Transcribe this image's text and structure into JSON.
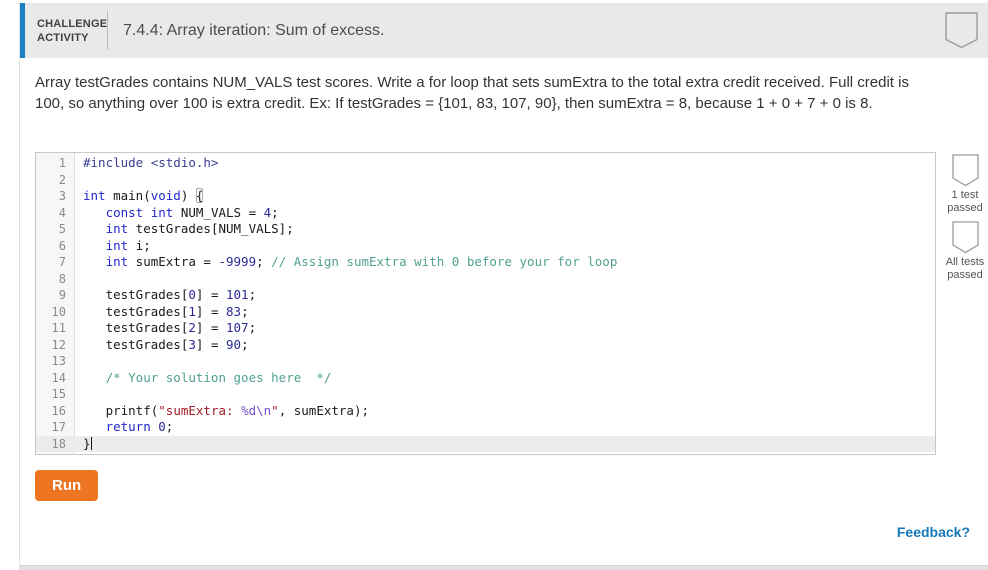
{
  "header": {
    "badge_line1": "CHALLENGE",
    "badge_line2": "ACTIVITY",
    "title": "7.4.4: Array iteration: Sum of excess.",
    "accent_color": "#1b80c4"
  },
  "description": "Array testGrades contains NUM_VALS test scores. Write a for loop that sets sumExtra to the total extra credit received. Full credit is 100, so anything over 100 is extra credit. Ex: If testGrades = {101, 83, 107, 90}, then sumExtra = 8, because 1 + 0 + 7 + 0 is 8.",
  "editor": {
    "language": "c",
    "active_line": 18,
    "lines": [
      {
        "n": 1,
        "tokens": [
          {
            "t": "meta",
            "s": "#include <stdio.h>"
          }
        ]
      },
      {
        "n": 2,
        "tokens": []
      },
      {
        "n": 3,
        "tokens": [
          {
            "t": "kw",
            "s": "int"
          },
          {
            "t": "pl",
            "s": " main("
          },
          {
            "t": "kw",
            "s": "void"
          },
          {
            "t": "pl",
            "s": ") "
          },
          {
            "t": "bracket",
            "s": "{"
          }
        ]
      },
      {
        "n": 4,
        "tokens": [
          {
            "t": "pl",
            "s": "   "
          },
          {
            "t": "kw",
            "s": "const"
          },
          {
            "t": "pl",
            "s": " "
          },
          {
            "t": "kw",
            "s": "int"
          },
          {
            "t": "pl",
            "s": " NUM_VALS = "
          },
          {
            "t": "num",
            "s": "4"
          },
          {
            "t": "pl",
            "s": ";"
          }
        ]
      },
      {
        "n": 5,
        "tokens": [
          {
            "t": "pl",
            "s": "   "
          },
          {
            "t": "kw",
            "s": "int"
          },
          {
            "t": "pl",
            "s": " testGrades[NUM_VALS];"
          }
        ]
      },
      {
        "n": 6,
        "tokens": [
          {
            "t": "pl",
            "s": "   "
          },
          {
            "t": "kw",
            "s": "int"
          },
          {
            "t": "pl",
            "s": " i;"
          }
        ]
      },
      {
        "n": 7,
        "tokens": [
          {
            "t": "pl",
            "s": "   "
          },
          {
            "t": "kw",
            "s": "int"
          },
          {
            "t": "pl",
            "s": " sumExtra = "
          },
          {
            "t": "num",
            "s": "-9999"
          },
          {
            "t": "pl",
            "s": "; "
          },
          {
            "t": "com",
            "s": "// Assign sumExtra with 0 before your for loop"
          }
        ]
      },
      {
        "n": 8,
        "tokens": []
      },
      {
        "n": 9,
        "tokens": [
          {
            "t": "pl",
            "s": "   testGrades["
          },
          {
            "t": "num",
            "s": "0"
          },
          {
            "t": "pl",
            "s": "] = "
          },
          {
            "t": "num",
            "s": "101"
          },
          {
            "t": "pl",
            "s": ";"
          }
        ]
      },
      {
        "n": 10,
        "tokens": [
          {
            "t": "pl",
            "s": "   testGrades["
          },
          {
            "t": "num",
            "s": "1"
          },
          {
            "t": "pl",
            "s": "] = "
          },
          {
            "t": "num",
            "s": "83"
          },
          {
            "t": "pl",
            "s": ";"
          }
        ]
      },
      {
        "n": 11,
        "tokens": [
          {
            "t": "pl",
            "s": "   testGrades["
          },
          {
            "t": "num",
            "s": "2"
          },
          {
            "t": "pl",
            "s": "] = "
          },
          {
            "t": "num",
            "s": "107"
          },
          {
            "t": "pl",
            "s": ";"
          }
        ]
      },
      {
        "n": 12,
        "tokens": [
          {
            "t": "pl",
            "s": "   testGrades["
          },
          {
            "t": "num",
            "s": "3"
          },
          {
            "t": "pl",
            "s": "] = "
          },
          {
            "t": "num",
            "s": "90"
          },
          {
            "t": "pl",
            "s": ";"
          }
        ]
      },
      {
        "n": 13,
        "tokens": []
      },
      {
        "n": 14,
        "tokens": [
          {
            "t": "pl",
            "s": "   "
          },
          {
            "t": "com",
            "s": "/* Your solution goes here  */"
          }
        ]
      },
      {
        "n": 15,
        "tokens": []
      },
      {
        "n": 16,
        "tokens": [
          {
            "t": "pl",
            "s": "   printf("
          },
          {
            "t": "str",
            "s": "\"sumExtra: "
          },
          {
            "t": "fmt",
            "s": "%d\\n"
          },
          {
            "t": "str",
            "s": "\""
          },
          {
            "t": "pl",
            "s": ", sumExtra);"
          }
        ]
      },
      {
        "n": 17,
        "tokens": [
          {
            "t": "pl",
            "s": "   "
          },
          {
            "t": "kw",
            "s": "return"
          },
          {
            "t": "pl",
            "s": " "
          },
          {
            "t": "num",
            "s": "0"
          },
          {
            "t": "pl",
            "s": ";"
          }
        ]
      },
      {
        "n": 18,
        "tokens": [
          {
            "t": "pl",
            "s": "}"
          }
        ],
        "cursor": true
      }
    ]
  },
  "tests": [
    {
      "line1": "1 test",
      "line2": "passed",
      "icon": "shield-outline-icon"
    },
    {
      "line1": "All tests",
      "line2": "passed",
      "icon": "shield-outline-icon"
    }
  ],
  "actions": {
    "run_label": "Run"
  },
  "footer": {
    "feedback_label": "Feedback?"
  },
  "colors": {
    "run_button": "#ee7623",
    "accent_blue": "#1b80c4",
    "link_blue": "#1779ba"
  }
}
